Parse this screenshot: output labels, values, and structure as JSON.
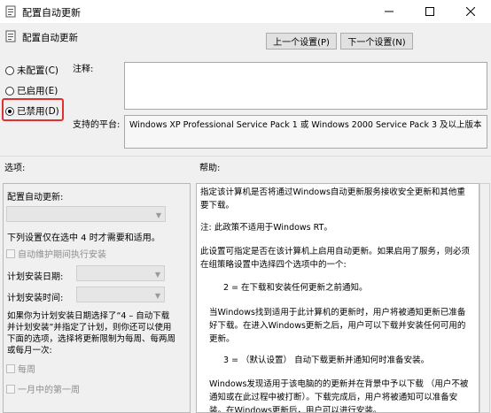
{
  "window": {
    "title": "配置自动更新"
  },
  "header": {
    "title": "配置自动更新",
    "prev_button": "上一个设置(P)",
    "next_button": "下一个设置(N)"
  },
  "state": {
    "options": [
      {
        "label": "未配置(C)",
        "checked": false
      },
      {
        "label": "已启用(E)",
        "checked": false
      },
      {
        "label": "已禁用(D)",
        "checked": true
      }
    ]
  },
  "comment": {
    "label": "注释:",
    "value": ""
  },
  "platform": {
    "label": "支持的平台:",
    "value": "Windows XP Professional Service Pack 1 或 Windows 2000 Service Pack 3 及以上版本"
  },
  "sections": {
    "options_label": "选项:",
    "help_label": "帮助:"
  },
  "options_panel": {
    "configure_label": "配置自动更新:",
    "note": "下列设置仅在选中 4 时才需要和适用。",
    "maintenance_checkbox": "自动维护期间执行安装",
    "install_day_label": "计划安装日期:",
    "install_time_label": "计划安装时间:",
    "desc": "如果你为计划安装日期选择了“4 – 自动下载并计划安装”并指定了计划，则你还可以使用下面的选项，选择将更新限制为每周、每两周或每月一次:",
    "every_week": "每周",
    "first_week": "一月中的第一周"
  },
  "help": {
    "p1": "指定该计算机是否将通过Windows自动更新服务接收安全更新和其他重要下载。",
    "p2": "注: 此政策不适用于Windows RT。",
    "p3": "此设置可指定是否在该计算机上启用自动更新。如果启用了服务，则必须在组策略设置中选择四个选项中的一个:",
    "p4": "2 = 在下载和安装任何更新之前通知。",
    "p5": "当Windows找到适用于此计算机的更新时，用户将被通知更新已准备好下载。在进入Windows更新之后，用户可以下载并安装任何可用的更新。",
    "p6": "3 = （默认设置） 自动下载更新并通知何时准备安装。",
    "p7": "Windows发现适用于该电脑的的更新并在背景中予以下载 （用户不被通知或在此过程中被打断）。下载完成后，用户将被通知可以准备安装。在Windows更新后，用户可以进行安装。"
  },
  "colors": {
    "highlight": "#e03030"
  }
}
